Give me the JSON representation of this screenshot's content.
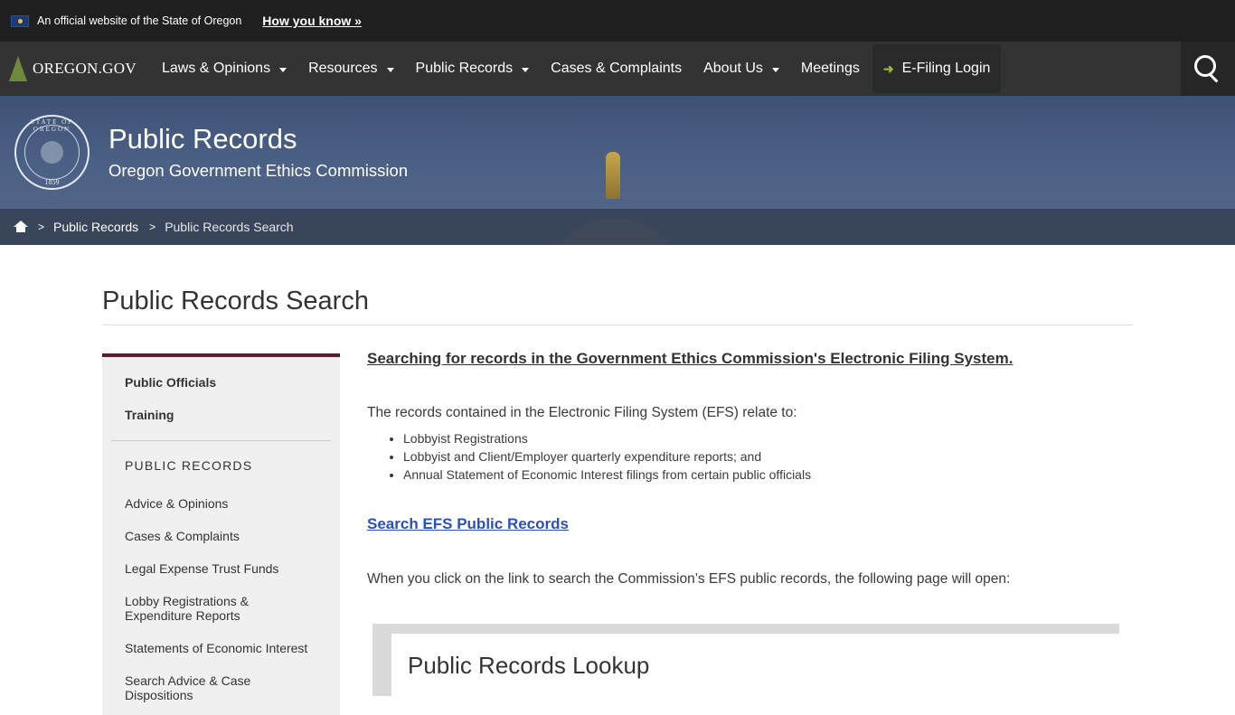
{
  "banner": {
    "text": "An official website of the State of Oregon",
    "link": "How you know »"
  },
  "nav": {
    "logo": "OREGON.GOV",
    "items": [
      {
        "label": "Laws & Opinions",
        "dropdown": true
      },
      {
        "label": "Resources",
        "dropdown": true
      },
      {
        "label": "Public Records",
        "dropdown": true
      },
      {
        "label": "Cases & Complaints",
        "dropdown": false
      },
      {
        "label": "About Us",
        "dropdown": true
      },
      {
        "label": "Meetings",
        "dropdown": false
      }
    ],
    "efile_label": "E-Filing Login"
  },
  "hero": {
    "title": "Public Records",
    "subtitle": "Oregon Government Ethics Commission",
    "seal_top": "STATE OF OREGON",
    "seal_year": "1859"
  },
  "breadcrumb": {
    "items": [
      "Public Records",
      "Public Records Search"
    ]
  },
  "page": {
    "title": "Public Records Search"
  },
  "sidebar": {
    "top_items": [
      "Public Officials",
      "Training"
    ],
    "section_heading": "PUBLIC RECORDS",
    "links": [
      "Advice & Opinions",
      "Cases & Complaints",
      "Legal Expense Trust Funds",
      "Lobby Registrations & Expenditure Reports",
      "Statements of Economic Interest",
      "Search Advice & Case Dispositions"
    ]
  },
  "main": {
    "heading": "Searching for records in the Government Ethics Commission's Electronic Filing System.",
    "intro": "The records contained in the Electronic Filing System (EFS) relate to:",
    "list": [
      "Lobbyist Registrations",
      "Lobbyist and Client/Employer quarterly expenditure reports; and",
      "Annual Statement of Economic Interest filings from certain public officials"
    ],
    "efs_link": "Search EFS Public Records",
    "click_text": "When you click on the link to search the Commission’s EFS public records, the following page will open:",
    "screenshot_title": "Public Records Lookup"
  },
  "colors": {
    "banner_bg": "#1f1f1f",
    "nav_bg": "#333333",
    "sidebar_accent": "#631a2e",
    "link_blue": "#2b4fbf",
    "efile_icon": "#8dbb3a"
  }
}
